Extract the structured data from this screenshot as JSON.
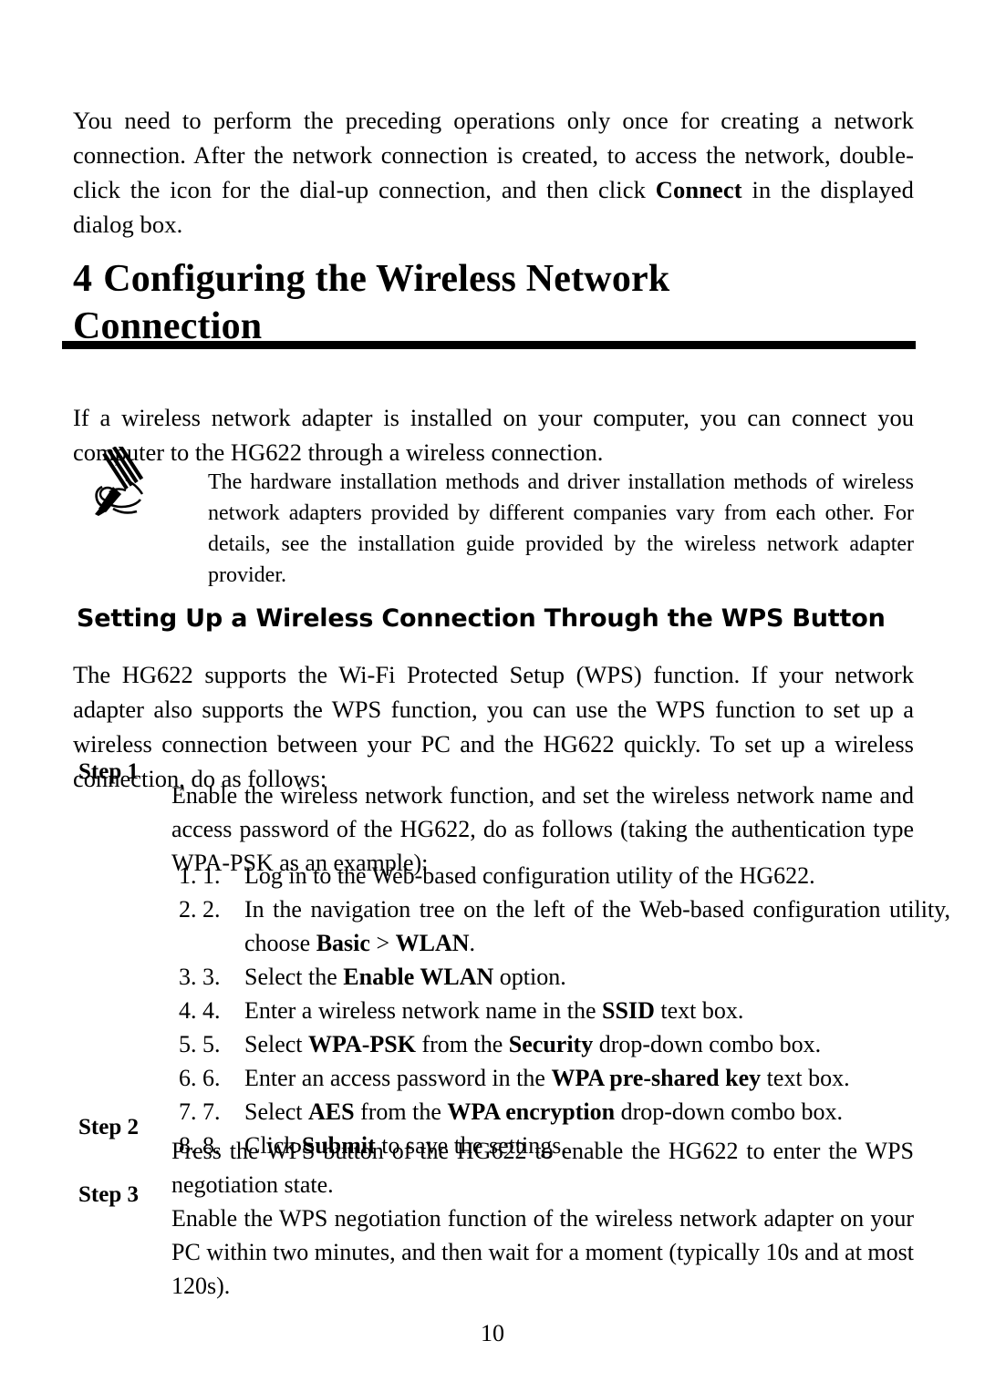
{
  "document": {
    "intro_paragraph": "You need to perform the preceding operations only once for creating a network connection. After the network connection is created, to access the network, double-click the icon for the dial-up connection, and then click ",
    "intro_bold": "Connect",
    "intro_paragraph_end": " in the displayed dialog box."
  },
  "chapter": {
    "number": "4",
    "title_line1": "Configuring the Wireless Network",
    "title_line2": "Connection"
  },
  "section_intro": {
    "text": "If a wireless network adapter is installed on your computer, you can connect you computer to the HG622 through a wireless connection."
  },
  "note": {
    "icon": "pen-note-icon",
    "text": "The hardware installation methods and driver installation methods of wireless network adapters provided by different companies vary from each other. For details, see the installation guide provided by the wireless network adapter provider."
  },
  "section": {
    "heading": "Setting Up a Wireless Connection Through the WPS Button",
    "paragraph": "The HG622 supports the Wi-Fi Protected Setup (WPS) function. If your network adapter also supports the WPS function, you can use the WPS function to set up a wireless connection between your PC and the HG622 quickly. To set up a wireless connection, do as follows:"
  },
  "steps": [
    {
      "label": "Step 1",
      "text": "Enable the wireless network function, and set the wireless network name and access password of the HG622, do as follows (taking the authentication type WPA-PSK as an example):"
    },
    {
      "label": "Step 2",
      "text": "Press the WPS button of the HG622 to enable the HG622 to enter the WPS negotiation state."
    },
    {
      "label": "Step 3",
      "text": "Enable the WPS negotiation function of the wireless network adapter on your PC within two minutes, and then wait for a moment (typically 10s and at most 120s)."
    }
  ],
  "substeps": [
    {
      "number": "1.",
      "parts": [
        {
          "text": "Log in to the Web-based configuration utility of the HG622.",
          "bold": false
        }
      ]
    },
    {
      "number": "2.",
      "parts": [
        {
          "text": "In the navigation tree on the left of the Web-based configuration utility, choose ",
          "bold": false
        },
        {
          "text": "Basic",
          "bold": true
        },
        {
          "text": " > ",
          "bold": false
        },
        {
          "text": "WLAN",
          "bold": true
        },
        {
          "text": ".",
          "bold": false
        }
      ]
    },
    {
      "number": "3.",
      "parts": [
        {
          "text": "Select the ",
          "bold": false
        },
        {
          "text": "Enable WLAN",
          "bold": true
        },
        {
          "text": " option.",
          "bold": false
        }
      ]
    },
    {
      "number": "4.",
      "parts": [
        {
          "text": "Enter a wireless network name in the ",
          "bold": false
        },
        {
          "text": "SSID",
          "bold": true
        },
        {
          "text": " text box.",
          "bold": false
        }
      ]
    },
    {
      "number": "5.",
      "parts": [
        {
          "text": "Select ",
          "bold": false
        },
        {
          "text": "WPA-PSK",
          "bold": true
        },
        {
          "text": " from the ",
          "bold": false
        },
        {
          "text": "Security",
          "bold": true
        },
        {
          "text": " drop-down combo box.",
          "bold": false
        }
      ]
    },
    {
      "number": "6.",
      "parts": [
        {
          "text": "Enter an access password in the ",
          "bold": false
        },
        {
          "text": "WPA pre-shared key",
          "bold": true
        },
        {
          "text": " text box.",
          "bold": false
        }
      ]
    },
    {
      "number": "7.",
      "parts": [
        {
          "text": "Select ",
          "bold": false
        },
        {
          "text": "AES",
          "bold": true
        },
        {
          "text": " from the ",
          "bold": false
        },
        {
          "text": "WPA encryption",
          "bold": true
        },
        {
          "text": " drop-down combo box.",
          "bold": false
        }
      ]
    },
    {
      "number": "8.",
      "parts": [
        {
          "text": "Click ",
          "bold": false
        },
        {
          "text": "Submit",
          "bold": true
        },
        {
          "text": " to save the settings.",
          "bold": false
        }
      ]
    }
  ],
  "footer": {
    "page_number": "10"
  }
}
